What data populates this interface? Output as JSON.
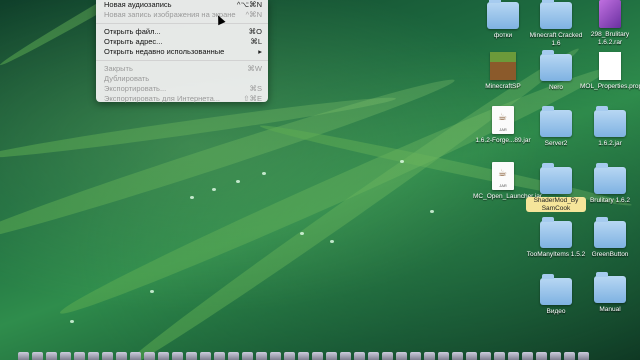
{
  "menu": {
    "items": [
      {
        "label": "Новая аудиозапись",
        "shortcut": "^⌥⌘N",
        "disabled": false
      },
      {
        "label": "Новая запись изображения на экране",
        "shortcut": "^⌘N",
        "disabled": true
      },
      {
        "separator": true
      },
      {
        "label": "Открыть файл...",
        "shortcut": "⌘O",
        "disabled": false
      },
      {
        "label": "Открыть адрес...",
        "shortcut": "⌘L",
        "disabled": false
      },
      {
        "label": "Открыть недавно использованные",
        "shortcut": "▸",
        "disabled": false
      },
      {
        "separator": true
      },
      {
        "label": "Закрыть",
        "shortcut": "⌘W",
        "disabled": true
      },
      {
        "label": "Дублировать",
        "shortcut": "",
        "disabled": true
      },
      {
        "label": "Экспортировать...",
        "shortcut": "⌘S",
        "disabled": true
      },
      {
        "label": "Экспортировать для Интернета...",
        "shortcut": "⇧⌘E",
        "disabled": true
      }
    ]
  },
  "desktop": {
    "icons": [
      {
        "name": "folder-icon",
        "type": "folder",
        "label": "фотки"
      },
      {
        "name": "folder-icon",
        "type": "folder",
        "label": "Minecraft Cracked 1.6"
      },
      {
        "name": "rar-file-icon",
        "type": "rar",
        "label": "298_Brulitary 1.6.2.rar"
      },
      {
        "name": "minecraft-icon",
        "type": "cube",
        "label": "MinecraftSP"
      },
      {
        "name": "folder-icon",
        "type": "folder",
        "label": "Nero"
      },
      {
        "name": "properties-file-icon",
        "type": "blank",
        "label": "MOL_Properties.properties"
      },
      {
        "name": "jar-file-icon",
        "type": "jar",
        "label": "1.6.2-Forge...89.jar"
      },
      {
        "name": "folder-icon",
        "type": "folder",
        "label": "Server2"
      },
      {
        "name": "folder-icon",
        "type": "folder",
        "label": "1.6.2.jar"
      },
      {
        "name": "jar-file-icon",
        "type": "jar",
        "label": "MC_Open_Launcher.jar"
      },
      {
        "name": "folder-icon",
        "type": "folder",
        "label": "ShaderMod_By SamCook",
        "selected": true
      },
      {
        "name": "folder-icon",
        "type": "folder",
        "label": "Brulitary 1.6.2"
      },
      {
        "name": "folder-icon",
        "type": "folder",
        "label": "TooManyItems 1.5.2"
      },
      {
        "name": "folder-icon",
        "type": "folder",
        "label": "GreenButton"
      },
      {
        "name": "folder-icon",
        "type": "folder",
        "label": "Видео"
      },
      {
        "name": "folder-icon",
        "type": "folder",
        "label": "Manual"
      }
    ],
    "jar_badge": "JAR"
  }
}
